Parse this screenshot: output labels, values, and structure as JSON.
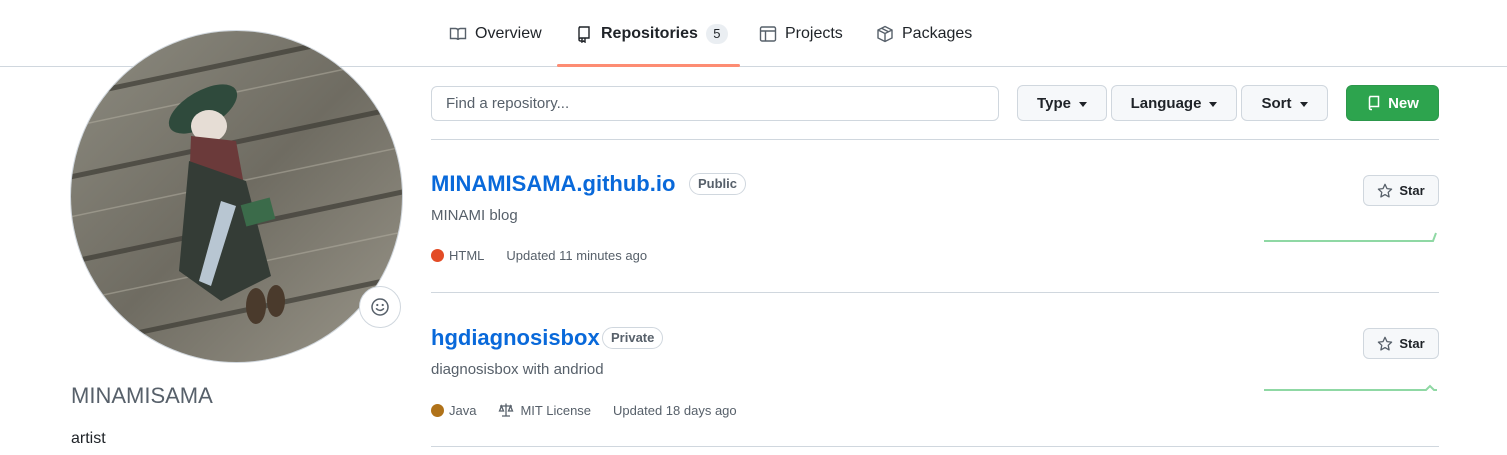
{
  "nav": {
    "tabs": [
      {
        "label": "Overview",
        "icon": "book-icon"
      },
      {
        "label": "Repositories",
        "icon": "repo-icon",
        "count": "5",
        "active": true
      },
      {
        "label": "Projects",
        "icon": "table-icon"
      },
      {
        "label": "Packages",
        "icon": "package-icon"
      }
    ]
  },
  "profile": {
    "username": "MINAMISAMA",
    "bio": "artist",
    "status_icon": "smiley-icon"
  },
  "toolbar": {
    "search_placeholder": "Find a repository...",
    "type_label": "Type",
    "language_label": "Language",
    "sort_label": "Sort",
    "new_label": "New",
    "new_color": "#2da44e"
  },
  "repos": [
    {
      "name": "MINAMISAMA.github.io",
      "visibility": "Public",
      "description": "MINAMI blog",
      "language": "HTML",
      "language_color": "#e34c26",
      "updated": "Updated 11 minutes ago",
      "star_label": "Star"
    },
    {
      "name": "hgdiagnosisbox",
      "visibility": "Private",
      "description": "diagnosisbox with andriod",
      "language": "Java",
      "language_color": "#b07219",
      "license": "MIT License",
      "updated": "Updated 18 days ago",
      "star_label": "Star"
    }
  ],
  "colors": {
    "link": "#0969da",
    "tab_underline": "#fd8c73",
    "sparkline": "#8fd8a4"
  }
}
